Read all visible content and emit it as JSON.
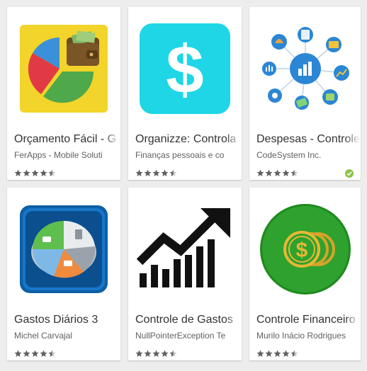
{
  "apps": [
    {
      "title": "Orçamento Fácil - G",
      "developer": "FerApps - Mobile Soluti",
      "rating": 4.5,
      "icon": "pie-wallet-icon"
    },
    {
      "title": "Organizze: Controla",
      "developer": "Finanças pessoais e co",
      "rating": 4.5,
      "icon": "dollar-sign-icon"
    },
    {
      "title": "Despesas - Controle",
      "developer": "CodeSystem Inc.",
      "rating": 4.5,
      "icon": "finance-hub-icon",
      "badge": "verified-check-icon"
    },
    {
      "title": "Gastos Diários 3",
      "developer": "Michel Carvajal",
      "rating": 4.5,
      "icon": "expense-pie-icon"
    },
    {
      "title": "Controle de Gastos",
      "developer": "NullPointerException Te",
      "rating": 4.5,
      "icon": "growth-chart-icon"
    },
    {
      "title": "Controle Financeiro",
      "developer": "Murilo Inácio Rodrigues",
      "rating": 4.5,
      "icon": "coins-icon"
    }
  ],
  "colors": {
    "star": "#616161",
    "star_empty": "#c8c8c8",
    "badge": "#8bc34a"
  }
}
